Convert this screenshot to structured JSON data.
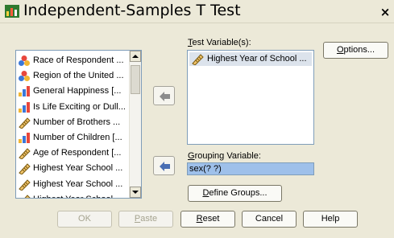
{
  "window": {
    "title": "Independent-Samples T Test",
    "close_glyph": "×"
  },
  "source_list": {
    "items": [
      {
        "label": "Race of Respondent ...",
        "icon": "nominal-icon"
      },
      {
        "label": "Region of the United ...",
        "icon": "nominal-icon"
      },
      {
        "label": "General Happiness [...",
        "icon": "ordinal-icon"
      },
      {
        "label": "Is Life Exciting or Dull...",
        "icon": "ordinal-icon"
      },
      {
        "label": "Number of Brothers ...",
        "icon": "scale-icon"
      },
      {
        "label": "Number of Children [...",
        "icon": "ordinal-icon"
      },
      {
        "label": "Age of Respondent [...",
        "icon": "scale-icon"
      },
      {
        "label": "Highest Year School ...",
        "icon": "scale-icon"
      },
      {
        "label": "Highest Year School ...",
        "icon": "scale-icon"
      },
      {
        "label": "Highest Year School ...",
        "icon": "scale-icon"
      }
    ]
  },
  "test_variables": {
    "label_prefix": "",
    "label_mnemonic": "T",
    "label_rest": "est Variable(s):",
    "items": [
      {
        "label": "Highest Year of School ...",
        "icon": "scale-icon"
      }
    ]
  },
  "grouping": {
    "label_mnemonic": "G",
    "label_rest": "rouping Variable:",
    "value": "sex(? ?)"
  },
  "buttons": {
    "options_mnemonic": "O",
    "options_rest": "ptions...",
    "define_groups_mnemonic": "D",
    "define_groups_rest": "efine Groups...",
    "ok": "OK",
    "paste_mnemonic": "P",
    "paste_rest": "aste",
    "reset_mnemonic": "R",
    "reset_rest": "eset",
    "cancel": "Cancel",
    "help": "Help"
  },
  "colors": {
    "dialog_bg": "#ece9d8",
    "selection": "#9ec0ea",
    "arrow_blue": "#4a6fb3",
    "arrow_gray": "#8c8c8c"
  }
}
